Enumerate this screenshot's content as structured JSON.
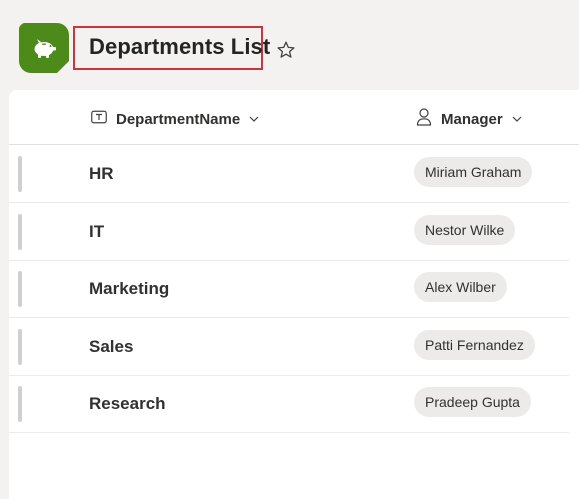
{
  "header": {
    "title": "Departments List",
    "app_icon": "piggy-bank-icon",
    "favorite_icon": "star-outline-icon",
    "brand_color": "#4c8a1a",
    "highlight_color": "#d13438"
  },
  "columns": [
    {
      "label": "DepartmentName",
      "icon": "text-field-icon",
      "menu_icon": "chevron-down-icon"
    },
    {
      "label": "Manager",
      "icon": "person-icon",
      "menu_icon": "chevron-down-icon"
    }
  ],
  "rows": [
    {
      "department": "HR",
      "manager": "Miriam Graham"
    },
    {
      "department": "IT",
      "manager": "Nestor Wilke"
    },
    {
      "department": "Marketing",
      "manager": "Alex Wilber"
    },
    {
      "department": "Sales",
      "manager": "Patti Fernandez"
    },
    {
      "department": "Research",
      "manager": "Pradeep Gupta"
    }
  ]
}
